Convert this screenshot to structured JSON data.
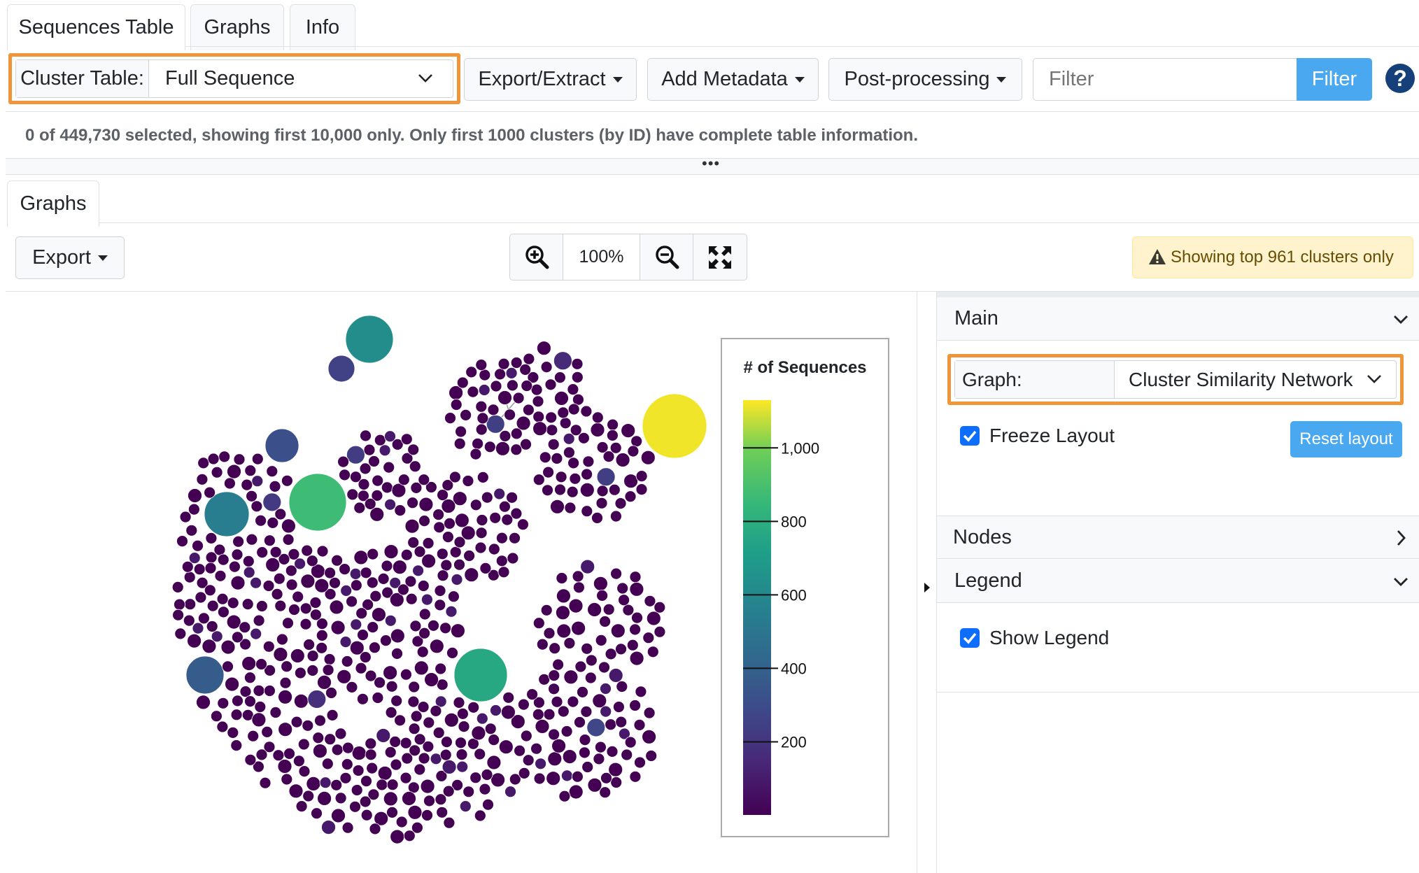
{
  "tabs": [
    "Sequences Table",
    "Graphs",
    "Info"
  ],
  "toolbar": {
    "cluster_table_label": "Cluster Table:",
    "cluster_table_value": "Full Sequence",
    "export_extract": "Export/Extract",
    "add_metadata": "Add Metadata",
    "post_processing": "Post-processing",
    "filter_placeholder": "Filter",
    "filter_button": "Filter",
    "help": "?"
  },
  "status_text": "0 of 449,730 selected, showing first 10,000 only. Only first 1000 clusters (by ID) have complete table information.",
  "splitter": "•••",
  "graph_tab": "Graphs",
  "graph_toolbar": {
    "export": "Export",
    "zoom_level": "100%",
    "warning": "Showing top 961 clusters only"
  },
  "legend": {
    "title": "# of Sequences",
    "ticks": [
      {
        "value": 1000,
        "label": "1,000"
      },
      {
        "value": 800,
        "label": "800"
      },
      {
        "value": 600,
        "label": "600"
      },
      {
        "value": 400,
        "label": "400"
      },
      {
        "value": 200,
        "label": "200"
      }
    ],
    "min": 1,
    "max": 1130,
    "colors": {
      "low": "#440154",
      "mid": "#21918c",
      "high": "#fde725"
    }
  },
  "panel": {
    "main_header": "Main",
    "graph_label": "Graph:",
    "graph_value": "Cluster Similarity Network",
    "freeze_layout": "Freeze Layout",
    "reset_layout": "Reset layout",
    "nodes_header": "Nodes",
    "legend_header": "Legend",
    "show_legend": "Show Legend"
  }
}
